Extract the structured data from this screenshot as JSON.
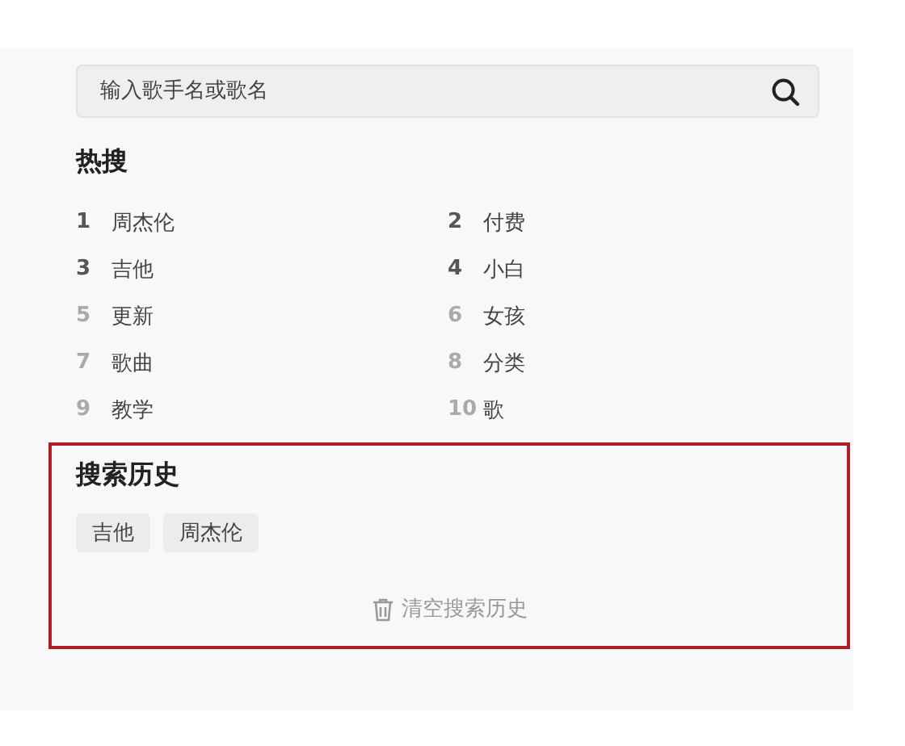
{
  "search": {
    "placeholder": "输入歌手名或歌名"
  },
  "hot_search": {
    "title": "热搜",
    "items": [
      {
        "rank": "1",
        "text": "周杰伦",
        "top": true
      },
      {
        "rank": "2",
        "text": "付费",
        "top": true
      },
      {
        "rank": "3",
        "text": "吉他",
        "top": true
      },
      {
        "rank": "4",
        "text": "小白",
        "top": true
      },
      {
        "rank": "5",
        "text": "更新",
        "top": false
      },
      {
        "rank": "6",
        "text": "女孩",
        "top": false
      },
      {
        "rank": "7",
        "text": "歌曲",
        "top": false
      },
      {
        "rank": "8",
        "text": "分类",
        "top": false
      },
      {
        "rank": "9",
        "text": "教学",
        "top": false
      },
      {
        "rank": "10",
        "text": "歌",
        "top": false
      }
    ]
  },
  "history": {
    "title": "搜索历史",
    "tags": [
      "吉他",
      "周杰伦"
    ],
    "clear_label": "清空搜索历史"
  }
}
